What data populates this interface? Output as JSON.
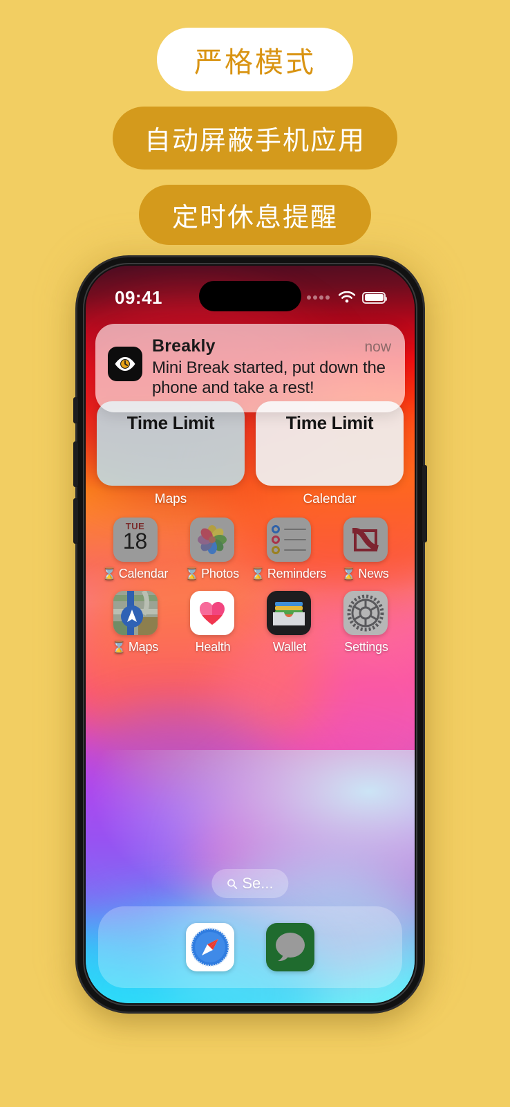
{
  "promo": {
    "pill_primary": "严格模式",
    "pill_secondary": "自动屏蔽手机应用",
    "pill_tertiary": "定时休息提醒",
    "colors": {
      "background": "#f2ce62",
      "pill_accent": "#d49a1c",
      "pill_text": "#d99413"
    }
  },
  "phone": {
    "status_bar": {
      "time": "09:41",
      "signal_icon": "signal-dots-icon",
      "wifi_icon": "wifi-icon",
      "battery_icon": "battery-icon"
    },
    "notification": {
      "app_icon": "eye-clock-icon",
      "app_name": "Breakly",
      "timestamp": "now",
      "message": "Mini Break started, put down the phone and take a rest!"
    },
    "widgets": [
      {
        "title": "Time Limit",
        "label": "Maps"
      },
      {
        "title": "Time Limit",
        "label": "Calendar"
      }
    ],
    "app_rows": [
      [
        {
          "label": "Calendar",
          "icon": "calendar-icon",
          "blocked": true,
          "blocked_glyph": "⌛",
          "day_abbr": "TUE",
          "day_num": "18"
        },
        {
          "label": "Photos",
          "icon": "photos-icon",
          "blocked": true,
          "blocked_glyph": "⌛"
        },
        {
          "label": "Reminders",
          "icon": "reminders-icon",
          "blocked": true,
          "blocked_glyph": "⌛"
        },
        {
          "label": "News",
          "icon": "news-icon",
          "blocked": true,
          "blocked_glyph": "⌛"
        }
      ],
      [
        {
          "label": "Maps",
          "icon": "maps-icon",
          "blocked": true,
          "blocked_glyph": "⌛"
        },
        {
          "label": "Health",
          "icon": "health-icon",
          "blocked": false,
          "blocked_glyph": ""
        },
        {
          "label": "Wallet",
          "icon": "wallet-icon",
          "blocked": false,
          "blocked_glyph": ""
        },
        {
          "label": "Settings",
          "icon": "settings-icon",
          "blocked": false,
          "blocked_glyph": ""
        }
      ]
    ],
    "search": {
      "icon": "search-icon",
      "label": "Se..."
    },
    "dock": [
      {
        "label": "Safari",
        "icon": "safari-icon"
      },
      {
        "label": "Messages",
        "icon": "messages-icon"
      }
    ]
  }
}
